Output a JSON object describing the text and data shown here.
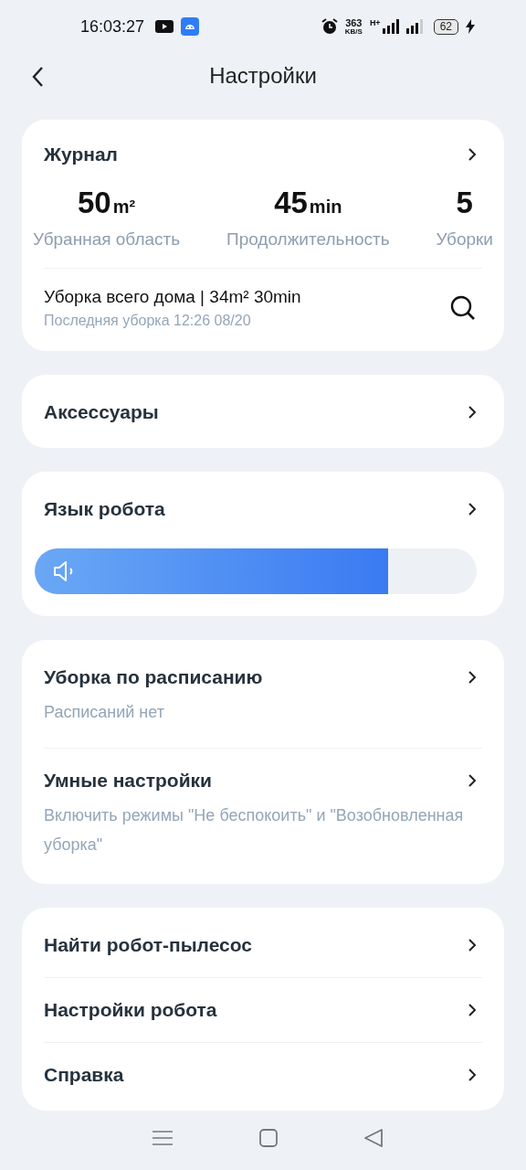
{
  "status_bar": {
    "time": "16:03:27",
    "speed": "363",
    "speed_unit": "KB/S",
    "network": "H+",
    "battery": "62"
  },
  "header": {
    "title": "Настройки"
  },
  "journal": {
    "title": "Журнал",
    "stats": [
      {
        "value": "50",
        "unit": "m²",
        "label": "Убранная область"
      },
      {
        "value": "45",
        "unit": "min",
        "label": "Продолжительность"
      },
      {
        "value": "5",
        "label": "Уборки"
      }
    ],
    "last": {
      "title": "Уборка всего дома | 34m² 30min",
      "subtitle": "Последняя уборка 12:26 08/20"
    }
  },
  "groups": [
    {
      "kind": "link",
      "items": [
        {
          "title": "Аксессуары"
        }
      ]
    },
    {
      "kind": "voice",
      "items": [
        {
          "title": "Язык робота"
        }
      ],
      "level": 0.8
    },
    {
      "kind": "link",
      "items": [
        {
          "title": "Уборка по расписанию",
          "subtitle": "Расписаний нет"
        },
        {
          "title": "Умные настройки",
          "subtitle": "Включить режимы \"Не беспокоить\" и \"Возобновленная уборка\""
        }
      ]
    },
    {
      "kind": "link",
      "items": [
        {
          "title": "Найти робот-пылесос"
        },
        {
          "title": "Настройки робота"
        },
        {
          "title": "Справка"
        }
      ]
    }
  ]
}
